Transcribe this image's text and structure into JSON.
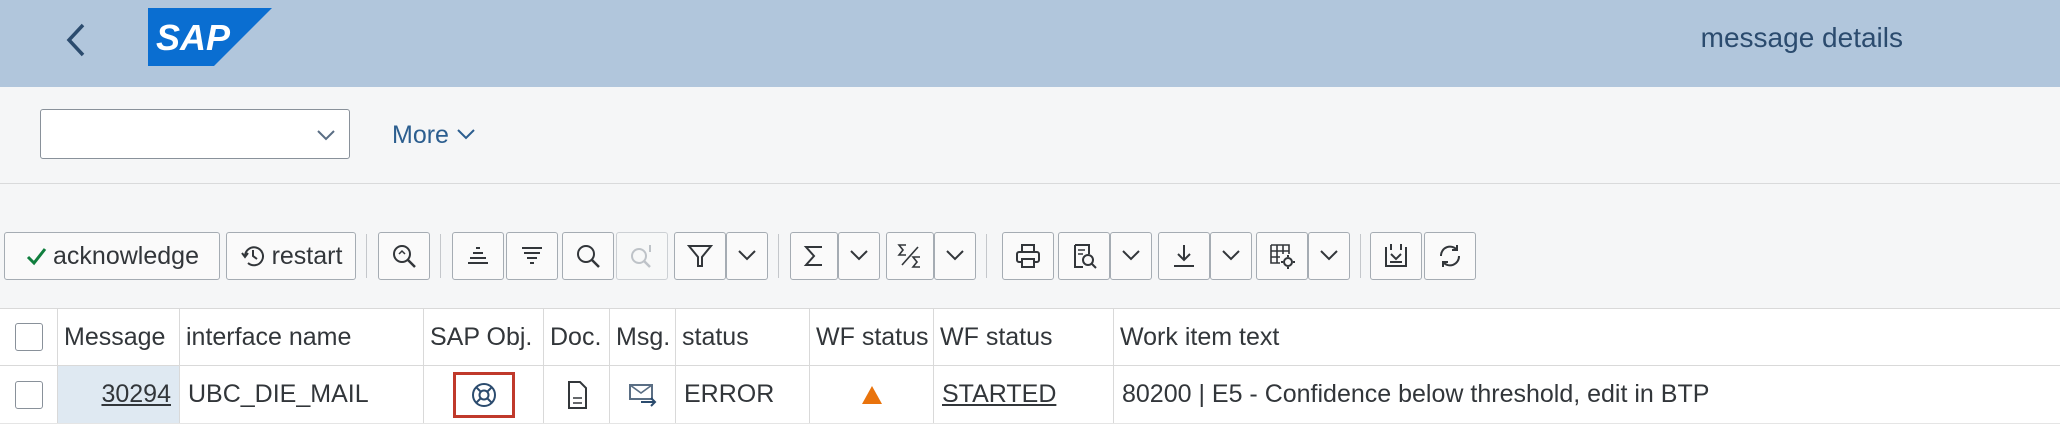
{
  "shell": {
    "title": "message details",
    "logo_text": "SAP",
    "brand_color": "#0a6ed1"
  },
  "header": {
    "variant_value": "",
    "more_label": "More"
  },
  "toolbar": {
    "acknowledge_label": "acknowledge",
    "restart_label": "restart",
    "icons": [
      "find-icon",
      "sort-ascending-icon",
      "sort-descending-icon",
      "search-icon",
      "search-next-icon",
      "filter-icon",
      "total-icon",
      "subtotal-icon",
      "print-icon",
      "view-icon",
      "export-icon",
      "layout-settings-icon",
      "graphic-icon",
      "refresh-icon"
    ]
  },
  "table": {
    "columns": [
      "Message",
      "interface name",
      "SAP Obj.",
      "Doc.",
      "Msg.",
      "status",
      "WF status",
      "WF status",
      "Work item text"
    ],
    "rows": [
      {
        "message": "30294",
        "interface_name": "UBC_DIE_MAIL",
        "sap_obj_icon": "object-icon",
        "doc_icon": "document-icon",
        "msg_icon": "message-icon",
        "status": "ERROR",
        "wf_status_icon": "warning-triangle-icon",
        "wf_status_text": "STARTED",
        "work_item_text": "80200 | E5 - Confidence below threshold, edit in BTP"
      }
    ]
  },
  "colors": {
    "shell_bg": "#b1c6dc",
    "warning": "#e9730c",
    "highlight_border": "#c0392b",
    "acknowledge_check": "#107e3e"
  }
}
